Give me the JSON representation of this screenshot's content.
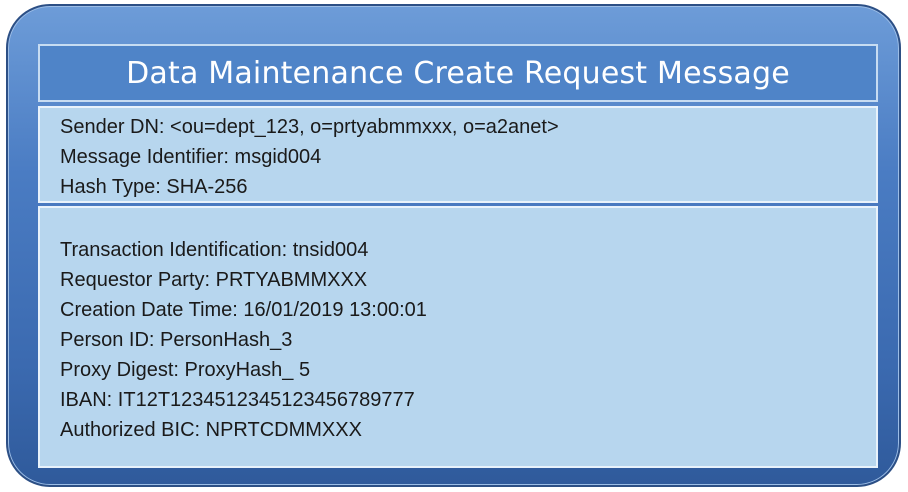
{
  "title": "Data Maintenance Create Request Message",
  "header_fields": [
    "Sender DN: <ou=dept_123, o=prtyabmmxxx, o=a2anet>",
    "Message Identifier: msgid004",
    "Hash Type: SHA-256"
  ],
  "body_fields": [
    "Transaction Identification: tnsid004",
    "Requestor Party: PRTYABMMXXX",
    "Creation Date Time: 16/01/2019 13:00:01",
    "Person ID: PersonHash_3",
    "Proxy Digest: ProxyHash_ 5",
    "IBAN: IT12T1234512345123456789777",
    "Authorized BIC: NPRTCDMMXXX"
  ]
}
